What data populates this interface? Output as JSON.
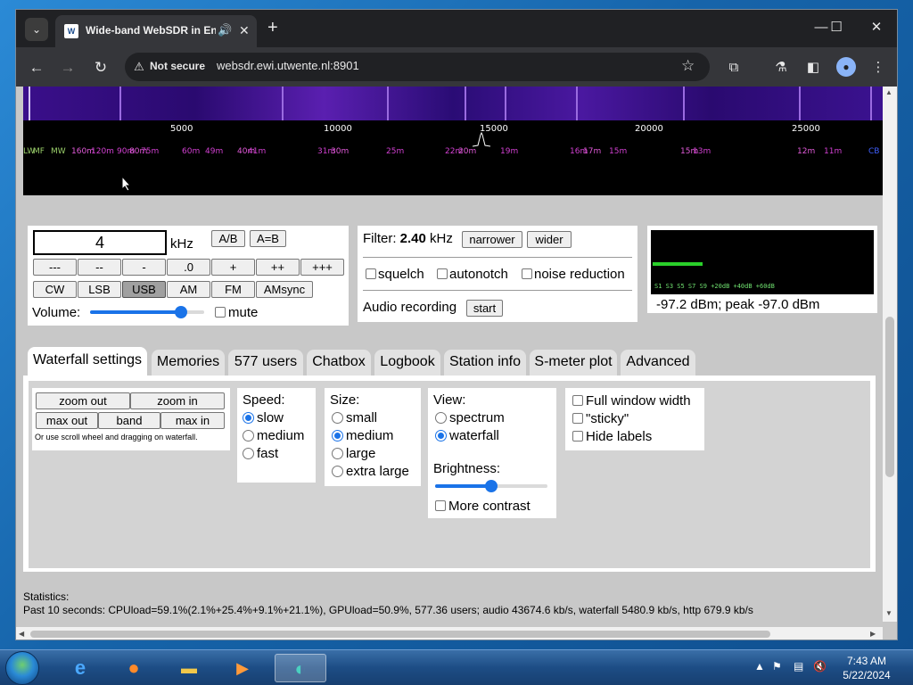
{
  "browser": {
    "tab_title": "Wide-band WebSDR in Ens",
    "favicon_text": "W",
    "not_secure": "Not secure",
    "url": "websdr.ewi.utwente.nl:8901"
  },
  "scale": {
    "ticks": [
      "5000",
      "10000",
      "15000",
      "20000",
      "25000"
    ],
    "bands": [
      {
        "label": "LW",
        "kind": "am"
      },
      {
        "label": "MF",
        "kind": "am"
      },
      {
        "label": "MW",
        "kind": "am"
      },
      {
        "label": "160m",
        "kind": "ham"
      },
      {
        "label": "120m",
        "kind": "bc"
      },
      {
        "label": "90m",
        "kind": "bc"
      },
      {
        "label": "80m",
        "kind": "ham"
      },
      {
        "label": "75m",
        "kind": "bc"
      },
      {
        "label": "60m",
        "kind": "bc"
      },
      {
        "label": "49m",
        "kind": "bc"
      },
      {
        "label": "40m",
        "kind": "ham"
      },
      {
        "label": "41m",
        "kind": "bc"
      },
      {
        "label": "31m",
        "kind": "bc"
      },
      {
        "label": "30m",
        "kind": "ham"
      },
      {
        "label": "25m",
        "kind": "bc"
      },
      {
        "label": "22m",
        "kind": "bc"
      },
      {
        "label": "20m",
        "kind": "ham"
      },
      {
        "label": "19m",
        "kind": "bc"
      },
      {
        "label": "16m",
        "kind": "bc"
      },
      {
        "label": "17m",
        "kind": "ham"
      },
      {
        "label": "15m",
        "kind": "bc"
      },
      {
        "label": "15m",
        "kind": "ham"
      },
      {
        "label": "13m",
        "kind": "bc"
      },
      {
        "label": "12m",
        "kind": "ham"
      },
      {
        "label": "11m",
        "kind": "bc"
      },
      {
        "label": "CB",
        "kind": "blue"
      }
    ]
  },
  "tuning": {
    "frequency": "4",
    "unit": "kHz",
    "ab": "A/B",
    "aeqb": "A=B",
    "steps": [
      "---",
      "--",
      "-",
      ".0",
      "+",
      "++",
      "+++"
    ],
    "modes": [
      "CW",
      "LSB",
      "USB",
      "AM",
      "FM",
      "AMsync"
    ],
    "active_mode": "USB",
    "volume_label": "Volume:",
    "volume_level": 0.8,
    "mute_label": "mute"
  },
  "filter": {
    "label": "Filter:",
    "value": "2.40",
    "unit": "kHz",
    "narrower": "narrower",
    "wider": "wider",
    "squelch": "squelch",
    "autonotch": "autonotch",
    "noise_reduction": "noise reduction",
    "recording_label": "Audio recording",
    "start": "start"
  },
  "smeter": {
    "scale": "S1   S3   S5   S7   S9   +20dB  +40dB  +60dB",
    "readout": "-97.2 dBm; peak  -97.0 dBm"
  },
  "tabs": [
    {
      "label": "Waterfall settings",
      "active": true
    },
    {
      "label": "Memories"
    },
    {
      "label": "577 users"
    },
    {
      "label": "Chatbox"
    },
    {
      "label": "Logbook"
    },
    {
      "label": "Station info"
    },
    {
      "label": "S-meter plot"
    },
    {
      "label": "Advanced"
    }
  ],
  "waterfall_settings": {
    "zoom_out": "zoom out",
    "zoom_in": "zoom in",
    "max_out": "max out",
    "band": "band",
    "max_in": "max in",
    "note": "Or use scroll wheel and dragging on waterfall.",
    "speed_title": "Speed:",
    "speed_options": [
      "slow",
      "medium",
      "fast"
    ],
    "speed_selected": "slow",
    "size_title": "Size:",
    "size_options": [
      "small",
      "medium",
      "large",
      "extra large"
    ],
    "size_selected": "medium",
    "view_title": "View:",
    "view_options": [
      "spectrum",
      "waterfall"
    ],
    "view_selected": "waterfall",
    "brightness_title": "Brightness:",
    "brightness_level": 0.5,
    "more_contrast": "More contrast",
    "full_width": "Full window width",
    "sticky": "\"sticky\"",
    "hide_labels": "Hide labels"
  },
  "stats": {
    "label": "Statistics:",
    "line": "Past 10 seconds: CPUload=59.1%(2.1%+25.4%+9.1%+21.1%), GPUload=50.9%, 577.36 users; audio 43674.6 kb/s, waterfall 5480.9 kb/s, http 679.9 kb/s"
  },
  "taskbar": {
    "time": "7:43 AM",
    "date": "5/22/2024"
  }
}
